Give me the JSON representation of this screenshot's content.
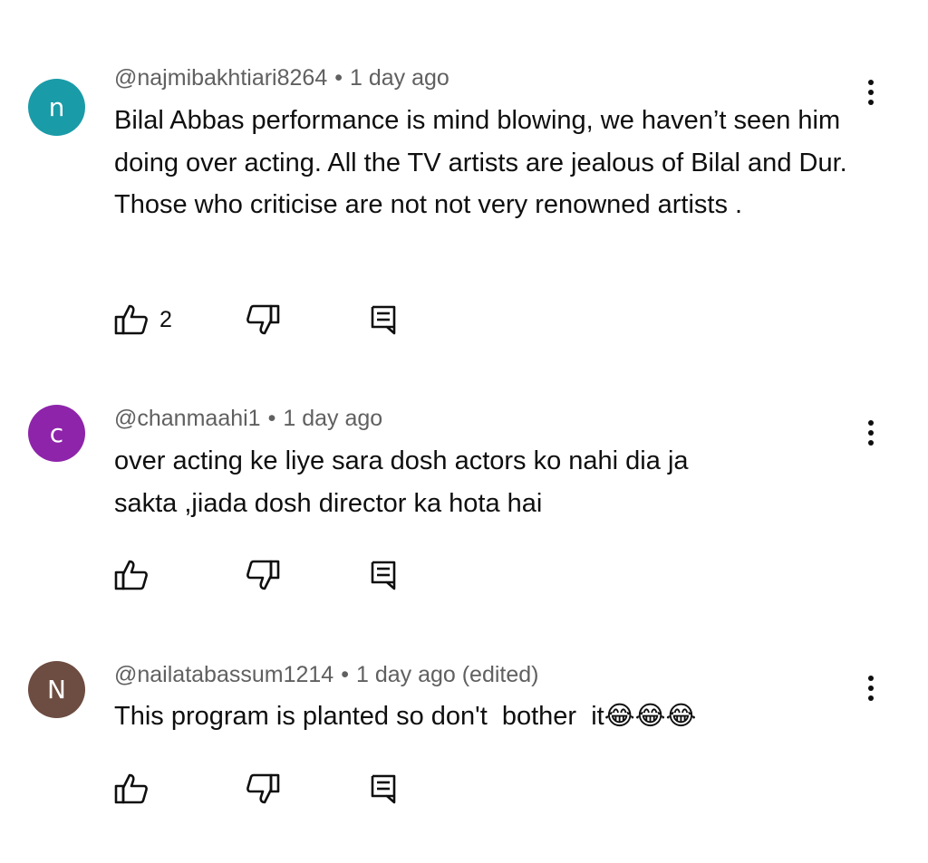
{
  "comments": [
    {
      "avatar_letter": "n",
      "avatar_color": "#1a9ba8",
      "username": "@najmibakhtiari8264",
      "separator": "•",
      "time": "1 day ago",
      "text": "Bilal Abbas performance is mind blowing, we haven’t seen him doing over acting. All the TV artists are jealous of Bilal and Dur. Those who criticise are not not very renowned artists .",
      "likes": "2"
    },
    {
      "avatar_letter": "c",
      "avatar_color": "#8e24aa",
      "username": "@chanmaahi1",
      "separator": "•",
      "time": "1 day ago",
      "text": "over acting ke liye sara dosh actors ko nahi dia ja sakta ,jiada dosh director ka hota hai",
      "likes": ""
    },
    {
      "avatar_letter": "N",
      "avatar_color": "#6d4c41",
      "username": "@nailatabassum1214",
      "separator": "•",
      "time": "1 day ago (edited)",
      "text": "This program is planted so don't  bother  it😂😂😂",
      "likes": ""
    }
  ],
  "icons": {
    "like": "thumb-up-icon",
    "dislike": "thumb-down-icon",
    "reply": "reply-icon",
    "menu": "more-vert-icon"
  }
}
